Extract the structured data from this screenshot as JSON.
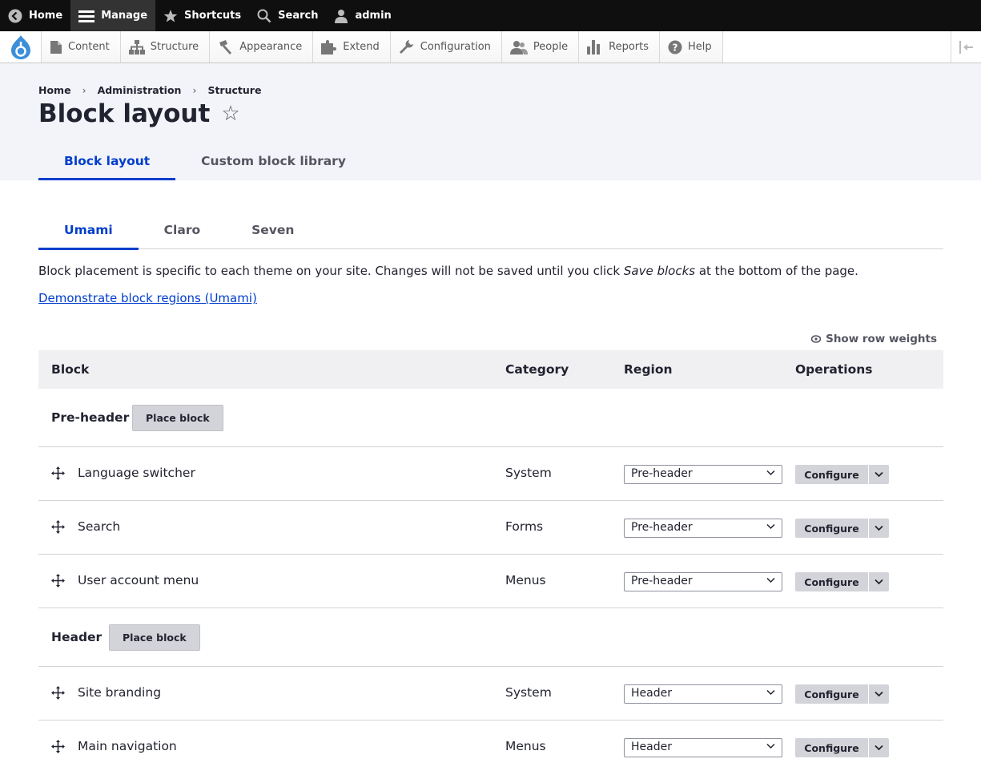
{
  "toolbar": {
    "items": [
      {
        "label": "Home",
        "icon": "back-circle-icon"
      },
      {
        "label": "Manage",
        "icon": "hamburger-icon"
      },
      {
        "label": "Shortcuts",
        "icon": "star-icon"
      },
      {
        "label": "Search",
        "icon": "search-icon"
      },
      {
        "label": "admin",
        "icon": "user-icon"
      }
    ]
  },
  "admin_menu": {
    "items": [
      {
        "label": "Content",
        "icon": "document-icon"
      },
      {
        "label": "Structure",
        "icon": "sitemap-icon"
      },
      {
        "label": "Appearance",
        "icon": "paintbrush-icon"
      },
      {
        "label": "Extend",
        "icon": "puzzle-icon"
      },
      {
        "label": "Configuration",
        "icon": "wrench-icon"
      },
      {
        "label": "People",
        "icon": "people-icon"
      },
      {
        "label": "Reports",
        "icon": "bar-chart-icon"
      },
      {
        "label": "Help",
        "icon": "help-icon"
      }
    ]
  },
  "breadcrumb": {
    "items": [
      "Home",
      "Administration",
      "Structure"
    ],
    "separator": "›"
  },
  "page": {
    "title": "Block layout",
    "star": "☆"
  },
  "primary_tabs": [
    "Block layout",
    "Custom block library"
  ],
  "theme_tabs": [
    "Umami",
    "Claro",
    "Seven"
  ],
  "description": {
    "before": "Block placement is specific to each theme on your site. Changes will not be saved until you click ",
    "emphasis": "Save blocks",
    "after": " at the bottom of the page."
  },
  "demo_link": "Demonstrate block regions (Umami)",
  "row_weights": "Show row weights",
  "table": {
    "headers": [
      "Block",
      "Category",
      "Region",
      "Operations"
    ],
    "place_block_label": "Place block",
    "configure_label": "Configure",
    "regions": [
      {
        "name": "Pre-header",
        "blocks": [
          {
            "name": "Language switcher",
            "category": "System",
            "region": "Pre-header"
          },
          {
            "name": "Search",
            "category": "Forms",
            "region": "Pre-header"
          },
          {
            "name": "User account menu",
            "category": "Menus",
            "region": "Pre-header"
          }
        ]
      },
      {
        "name": "Header",
        "blocks": [
          {
            "name": "Site branding",
            "category": "System",
            "region": "Header"
          },
          {
            "name": "Main navigation",
            "category": "Menus",
            "region": "Header"
          }
        ]
      }
    ]
  }
}
